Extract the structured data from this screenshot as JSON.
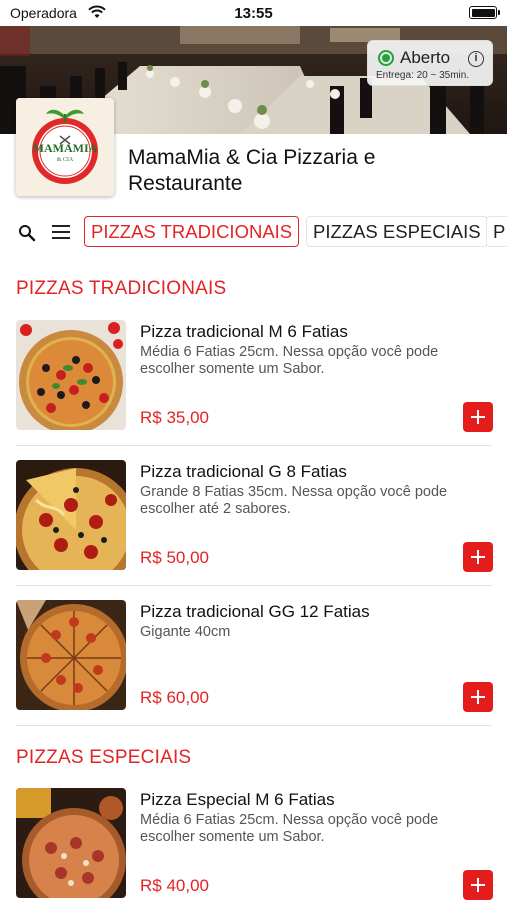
{
  "status_bar": {
    "carrier": "Operadora",
    "time": "13:55"
  },
  "store": {
    "name": "MamaMia & Cia Pizzaria e Restaurante",
    "open_status": "Aberto",
    "delivery_time": "Entrega: 20 ~ 35min.",
    "logo_text": "MAMAMIA",
    "logo_subtext": "& CIA"
  },
  "categories": {
    "tabs": [
      {
        "label": "PIZZAS TRADICIONAIS",
        "active": true
      },
      {
        "label": "PIZZAS ESPECIAIS",
        "active": false
      },
      {
        "label": "P",
        "active": false
      }
    ]
  },
  "sections": [
    {
      "title": "PIZZAS TRADICIONAIS",
      "products": [
        {
          "name": "Pizza tradicional M 6 Fatias",
          "description": "Média 6 Fatias 25cm. Nessa opção você pode escolher somente um Sabor.",
          "price": "R$ 35,00"
        },
        {
          "name": "Pizza tradicional G 8 Fatias",
          "description": "Grande 8 Fatias 35cm. Nessa opção você pode escolher até 2 sabores.",
          "price": "R$ 50,00"
        },
        {
          "name": "Pizza tradicional GG 12 Fatias",
          "description": "Gigante 40cm",
          "price": "R$ 60,00"
        }
      ]
    },
    {
      "title": "PIZZAS ESPECIAIS",
      "products": [
        {
          "name": "Pizza Especial M 6 Fatias",
          "description": "Média 6 Fatias 25cm. Nessa opção você pode escolher somente um Sabor.",
          "price": "R$ 40,00"
        }
      ]
    }
  ],
  "colors": {
    "accent": "#e32424",
    "open": "#22a33c"
  },
  "icons": [
    "wifi-icon",
    "battery-icon",
    "open-status-icon",
    "info-icon",
    "search-icon",
    "menu-icon",
    "add-icon"
  ]
}
